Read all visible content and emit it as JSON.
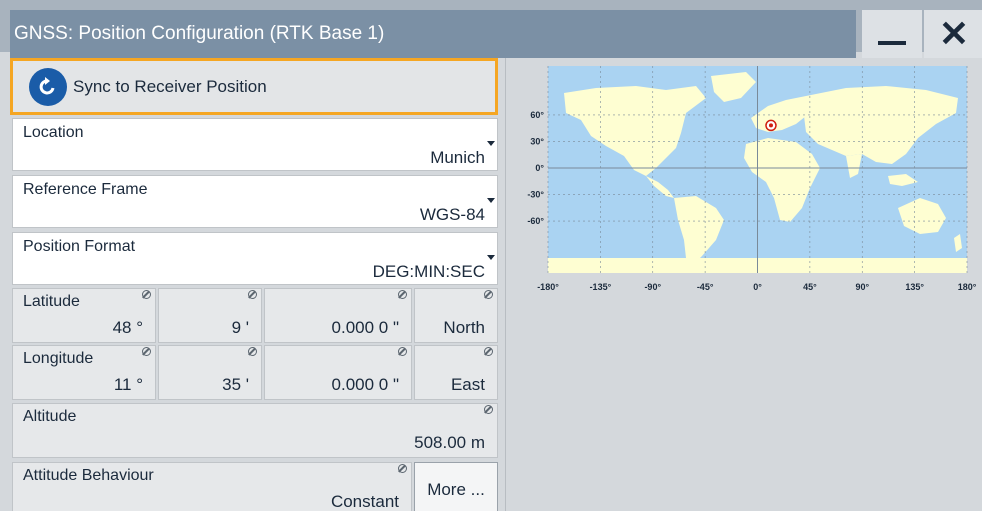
{
  "window": {
    "title": "GNSS: Position Configuration (RTK Base 1)",
    "minimize_icon": "minimize-icon",
    "close_icon": "close-icon",
    "close_glyph": "✕"
  },
  "sync": {
    "label": "Sync to Receiver Position",
    "icon": "sync-icon"
  },
  "location": {
    "caption": "Location",
    "value": "Munich"
  },
  "reference_frame": {
    "caption": "Reference Frame",
    "value": "WGS-84"
  },
  "position_format": {
    "caption": "Position Format",
    "value": "DEG:MIN:SEC"
  },
  "latitude": {
    "caption": "Latitude",
    "deg": "48 °",
    "min": "9 '",
    "sec": "0.000 0 \"",
    "dir": "North"
  },
  "longitude": {
    "caption": "Longitude",
    "deg": "11 °",
    "min": "35 '",
    "sec": "0.000 0 \"",
    "dir": "East"
  },
  "altitude": {
    "caption": "Altitude",
    "value": "508.00 m"
  },
  "attitude": {
    "caption": "Attitude Behaviour",
    "value": "Constant"
  },
  "more_button": {
    "label": "More ..."
  },
  "map": {
    "lat_ticks": [
      "60°",
      "30°",
      "0°",
      "-30°",
      "-60°"
    ],
    "lon_ticks": [
      "-180°",
      "-135°",
      "-90°",
      "-45°",
      "0°",
      "45°",
      "90°",
      "135°",
      "180°"
    ],
    "marker_lat": 48.15,
    "marker_lon": 11.58,
    "colors": {
      "ocean": "#aad3f2",
      "land": "#fefed2",
      "marker": "#d02010",
      "grid": "#7a8a99"
    }
  }
}
